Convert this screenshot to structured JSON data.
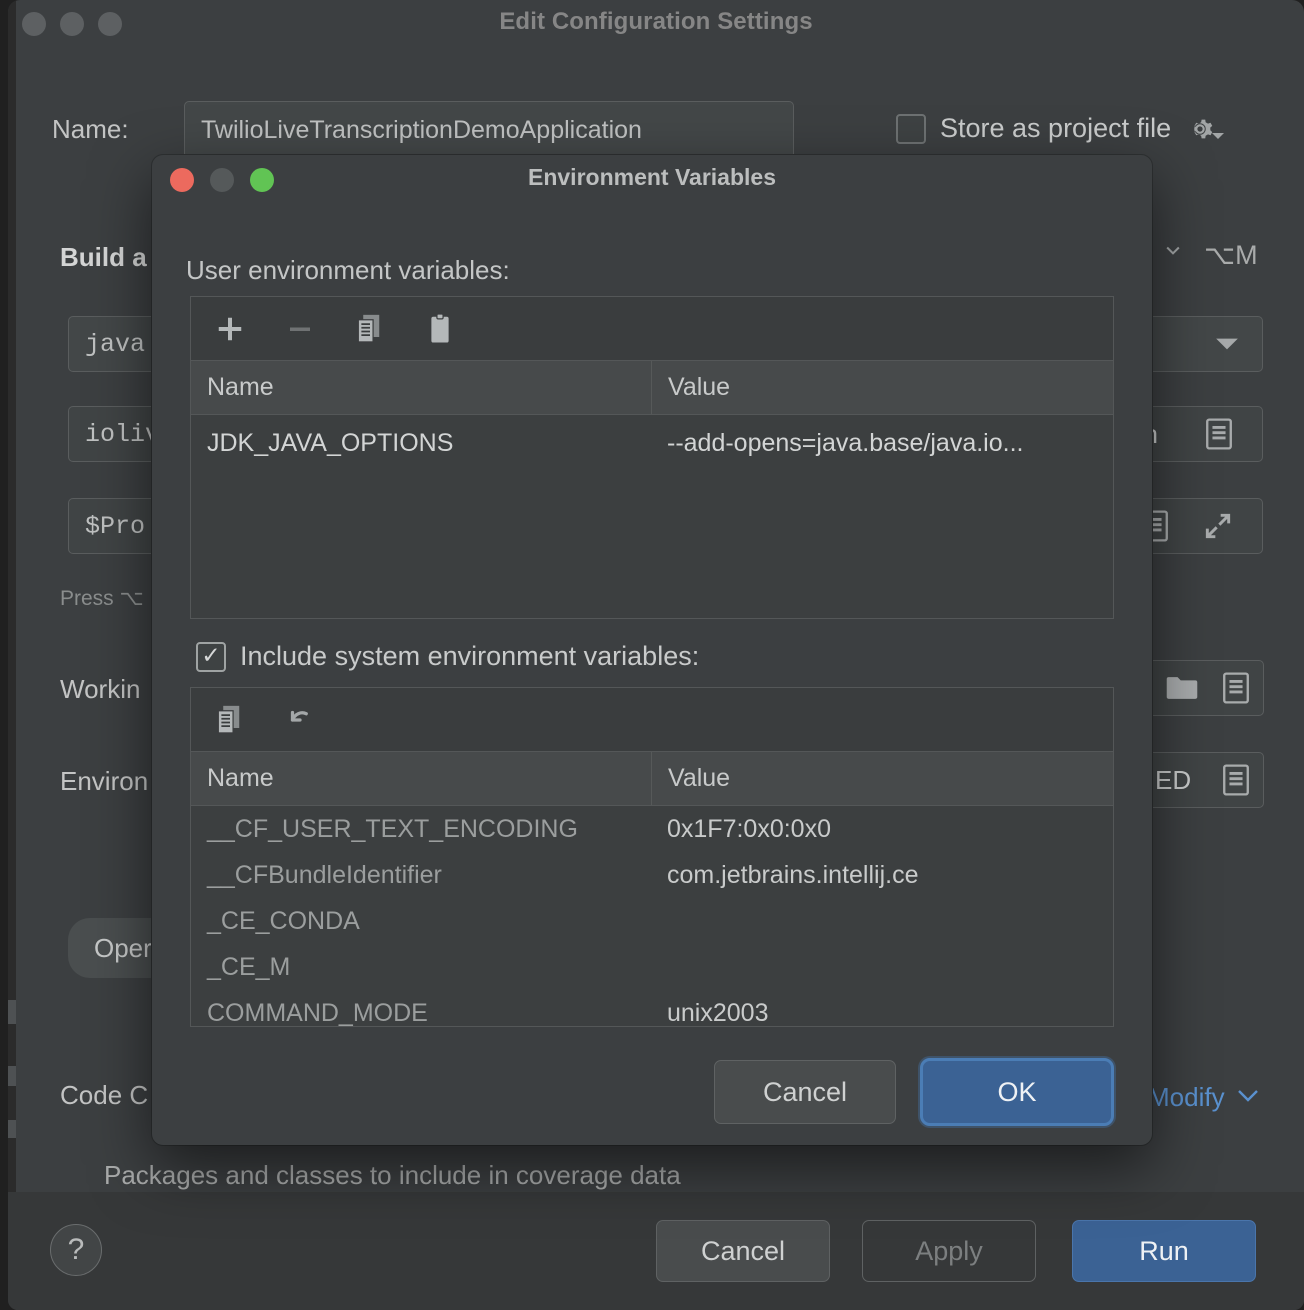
{
  "parent_window": {
    "title": "Edit Configuration Settings",
    "traffic_lights": [
      "minimize-grey",
      "grey",
      "grey"
    ],
    "name_label": "Name:",
    "name_value": "TwilioLiveTranscriptionDemoApplication",
    "store_as_project_file_label": "Store as project file",
    "store_as_project_file_checked": false,
    "gear_icon": "gear-icon",
    "build_and_run_label": "Build a",
    "build_shortcut": "⌥M",
    "jdk_field": "java",
    "module_field": "ioliv",
    "classpath_field": "$Pro",
    "press_hint": "Press ⌥",
    "working_directory_label": "Workin",
    "environment_label": "Environ",
    "operate_pill": "Oper",
    "code_coverage_label": "Code C",
    "coverage_hint": "Packages and classes to include in coverage data",
    "env_value_tail": "ED",
    "module_value_tail": "on",
    "modify_link": "Modify",
    "bottom_buttons": {
      "help": "?",
      "cancel": "Cancel",
      "apply": "Apply",
      "run": "Run"
    }
  },
  "modal": {
    "title": "Environment Variables",
    "traffic_lights": {
      "close": "#ec6a5e",
      "minimize": "#55595a",
      "zoom": "#61c454"
    },
    "user_section_label": "User environment variables:",
    "user_toolbar": [
      {
        "name": "add-icon",
        "glyph": "+",
        "enabled": true
      },
      {
        "name": "remove-icon",
        "glyph": "−",
        "enabled": false
      },
      {
        "name": "copy-icon",
        "glyph": "copy",
        "enabled": true
      },
      {
        "name": "paste-icon",
        "glyph": "paste",
        "enabled": true
      }
    ],
    "user_table": {
      "columns": [
        "Name",
        "Value"
      ],
      "rows": [
        {
          "name": "JDK_JAVA_OPTIONS",
          "value": "--add-opens=java.base/java.io..."
        }
      ]
    },
    "include_system_label": "Include system environment variables:",
    "include_system_checked": true,
    "system_toolbar": [
      {
        "name": "copy-icon",
        "glyph": "copy",
        "enabled": true
      },
      {
        "name": "revert-icon",
        "glyph": "revert",
        "enabled": true
      }
    ],
    "system_table": {
      "columns": [
        "Name",
        "Value"
      ],
      "rows": [
        {
          "name": "__CF_USER_TEXT_ENCODING",
          "value": "0x1F7:0x0:0x0"
        },
        {
          "name": "__CFBundleIdentifier",
          "value": "com.jetbrains.intellij.ce"
        },
        {
          "name": "_CE_CONDA",
          "value": ""
        },
        {
          "name": "_CE_M",
          "value": ""
        },
        {
          "name": "COMMAND_MODE",
          "value": "unix2003"
        }
      ]
    },
    "buttons": {
      "cancel": "Cancel",
      "ok": "OK"
    }
  },
  "colors": {
    "window_bg": "#3c3f41",
    "dialog_bg": "#3c3f41",
    "accent_blue": "#3b6294",
    "focus_ring": "#4b7db5",
    "link_blue": "#5a91cf",
    "text_primary": "#c9cbcb",
    "text_dim": "#8a8d8d"
  }
}
